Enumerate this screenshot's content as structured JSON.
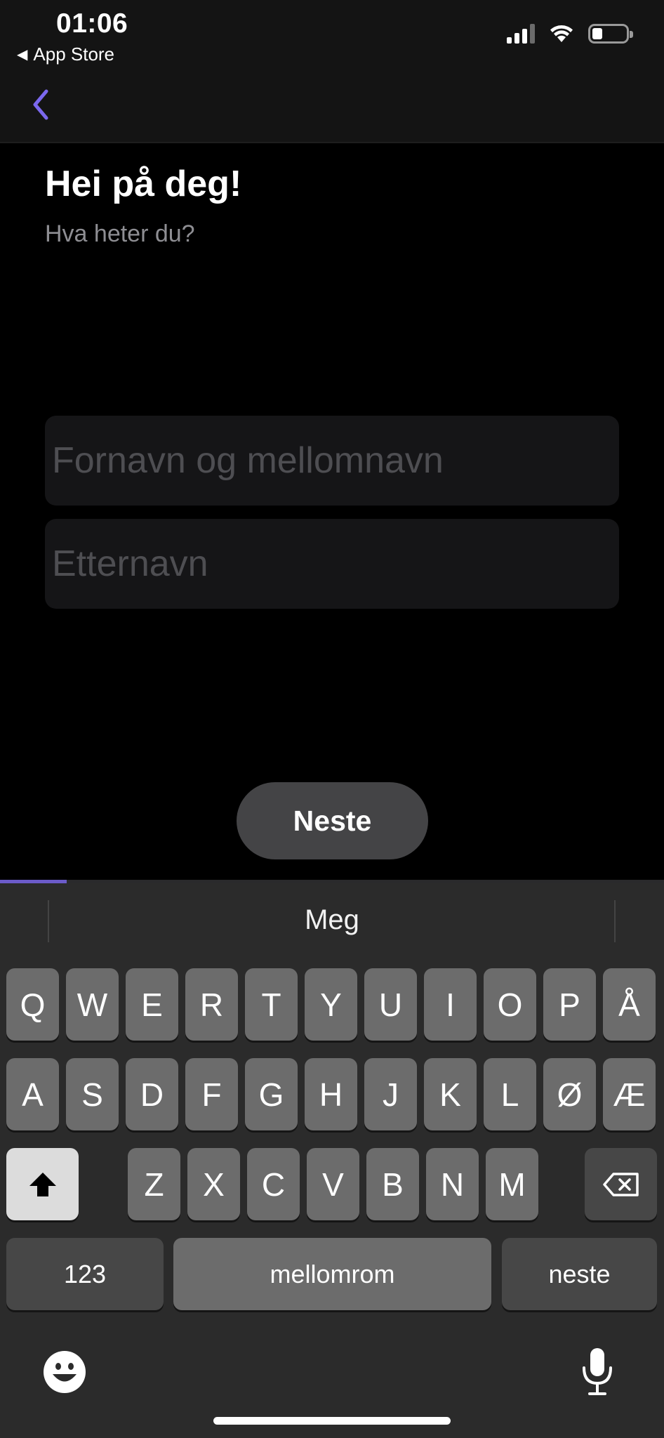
{
  "status_bar": {
    "time": "01:06",
    "back_app_label": "App Store",
    "icons": [
      "cellular-signal-icon",
      "wifi-icon",
      "battery-icon"
    ]
  },
  "nav": {
    "back_icon": "chevron-left-icon"
  },
  "header": {
    "title": "Hei på deg!",
    "subtitle": "Hva heter du?"
  },
  "form": {
    "first_name": {
      "placeholder": "Fornavn og mellomnavn",
      "value": ""
    },
    "last_name": {
      "placeholder": "Etternavn",
      "value": ""
    }
  },
  "next_button": {
    "label": "Neste"
  },
  "progress": {
    "fraction": 0.1
  },
  "keyboard": {
    "suggestion": "Meg",
    "row1": [
      "Q",
      "W",
      "E",
      "R",
      "T",
      "Y",
      "U",
      "I",
      "O",
      "P",
      "Å"
    ],
    "row2": [
      "A",
      "S",
      "D",
      "F",
      "G",
      "H",
      "J",
      "K",
      "L",
      "Ø",
      "Æ"
    ],
    "row3": [
      "Z",
      "X",
      "C",
      "V",
      "B",
      "N",
      "M"
    ],
    "numbers_label": "123",
    "space_label": "mellomrom",
    "return_label": "neste",
    "icons": [
      "shift-icon",
      "delete-icon",
      "emoji-icon",
      "microphone-icon"
    ]
  },
  "colors": {
    "accent": "#7b68ee",
    "background": "#000000",
    "field_background": "#151517"
  }
}
